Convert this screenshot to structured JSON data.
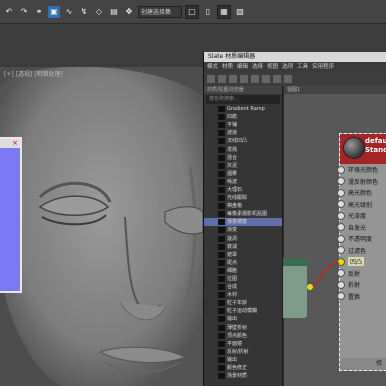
{
  "toolbar": {
    "dropdown": "创建选择集",
    "icons": [
      "undo-icon",
      "redo-icon",
      "link-icon",
      "unlink-icon",
      "bind-icon",
      "select-icon",
      "select-region-icon",
      "select-by-name-icon",
      "move-icon",
      "rotate-icon",
      "scale-icon",
      "material-editor-icon",
      "render-icon"
    ]
  },
  "viewport": {
    "label": "[+] [透视] [明暗处理]"
  },
  "slate": {
    "title": "Slate 材质编辑器",
    "menu": [
      "模式",
      "材质",
      "编辑",
      "选择",
      "视图",
      "选项",
      "工具",
      "实用程序"
    ],
    "browser": {
      "header": "材质/贴图浏览器",
      "search": "按名称搜索...",
      "items": [
        {
          "label": "Gradient Ramp",
          "highlight": false
        },
        {
          "label": "凹痕",
          "highlight": false
        },
        {
          "label": "平铺",
          "highlight": false
        },
        {
          "label": "波浪",
          "highlight": false
        },
        {
          "label": "法线凹凸",
          "highlight": false
        },
        {
          "label": "泼溅",
          "highlight": false
        },
        {
          "label": "混合",
          "highlight": false
        },
        {
          "label": "灰泥",
          "highlight": false
        },
        {
          "label": "烟雾",
          "highlight": false
        },
        {
          "label": "噪波",
          "highlight": false
        },
        {
          "label": "大理石",
          "highlight": false
        },
        {
          "label": "光线跟踪",
          "highlight": false
        },
        {
          "label": "棋盘格",
          "highlight": false
        },
        {
          "label": "每像素摄影机贴图",
          "highlight": false
        },
        {
          "label": "渐变坡度",
          "highlight": true
        },
        {
          "label": "渐变",
          "highlight": false
        },
        {
          "label": "漩涡",
          "highlight": false
        },
        {
          "label": "衰减",
          "highlight": false
        },
        {
          "label": "遮罩",
          "highlight": false
        },
        {
          "label": "斑点",
          "highlight": false
        },
        {
          "label": "细胞",
          "highlight": false
        },
        {
          "label": "位图",
          "highlight": false
        },
        {
          "label": "合成",
          "highlight": false
        },
        {
          "label": "木材",
          "highlight": false
        },
        {
          "label": "粒子年龄",
          "highlight": false
        },
        {
          "label": "粒子运动模糊",
          "highlight": false
        },
        {
          "label": "输出",
          "highlight": false
        },
        {
          "label": "薄壁折射",
          "highlight": false
        },
        {
          "label": "顶点颜色",
          "highlight": false
        },
        {
          "label": "平面镜",
          "highlight": false
        },
        {
          "label": "反射/折射",
          "highlight": false
        },
        {
          "label": "输出",
          "highlight": false
        },
        {
          "label": "颜色修正",
          "highlight": false
        },
        {
          "label": "场景材质",
          "highlight": false
        }
      ]
    },
    "view_tab": "视图1",
    "node": {
      "name_line1": "defau",
      "name_line2": "Stand",
      "slots": [
        "环境光颜色",
        "漫反射颜色",
        "高光颜色",
        "高光级别",
        "光泽度",
        "自发光",
        "不透明度",
        "过滤色",
        "凹凸",
        "反射",
        "折射",
        "置换"
      ],
      "highlight_slot": 8,
      "footer": "修"
    }
  }
}
